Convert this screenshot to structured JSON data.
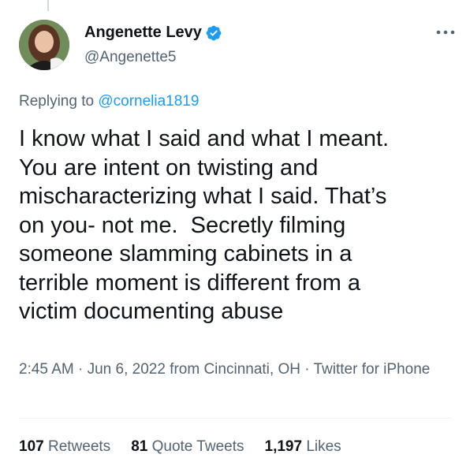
{
  "author": {
    "display_name": "Angenette Levy",
    "handle": "@Angenette5",
    "verified_icon": "verified-badge-icon",
    "avatar_icon": "profile-photo"
  },
  "reply": {
    "prefix": "Replying to ",
    "to": "@cornelia1819"
  },
  "tweet": {
    "text": "I know what I said and what I meant.\nYou are intent on twisting and\nmischaracterizing what I said. That’s\non you- not me.  Secretly filming\nsomeone slamming cabinets in a\nterrible moment is different from a\nvictim documenting abuse",
    "meta": "2:45 AM · Jun 6, 2022 from Cincinnati, OH · Twitter for iPhone"
  },
  "stats": {
    "retweets_count": "107",
    "retweets_label": " Retweets",
    "quotes_count": "81",
    "quotes_label": " Quote Tweets",
    "likes_count": "1,197",
    "likes_label": " Likes"
  },
  "colors": {
    "accent": "#1d9bf0",
    "secondary_text": "#536471",
    "primary_text": "#0f1419"
  }
}
